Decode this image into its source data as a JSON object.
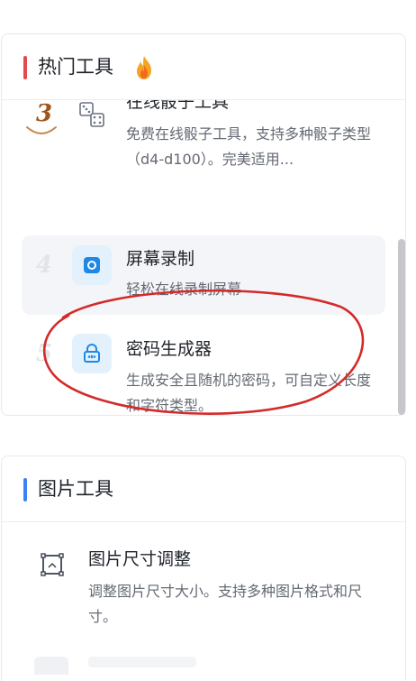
{
  "hot_tools": {
    "title": "热门工具",
    "accent_color": "#e5484d",
    "title_icon": "fire-icon",
    "items": [
      {
        "rank": "3",
        "icon": "dice-icon",
        "title": "在线骰子工具",
        "description": "免费在线骰子工具，支持多种骰子类型（d4-d100）。完美适用..."
      },
      {
        "rank": "4",
        "icon": "screen-record-icon",
        "title": "屏幕录制",
        "description": "轻松在线录制屏幕"
      },
      {
        "rank": "5",
        "icon": "password-lock-icon",
        "title": "密码生成器",
        "description": "生成安全且随机的密码，可自定义长度和字符类型。"
      }
    ]
  },
  "image_tools": {
    "title": "图片工具",
    "accent_color": "#3b82f6",
    "items": [
      {
        "icon": "image-resize-icon",
        "title": "图片尺寸调整",
        "description": "调整图片尺寸大小。支持多种图片格式和尺寸。"
      }
    ]
  },
  "annotation_color": "#d42a2a"
}
